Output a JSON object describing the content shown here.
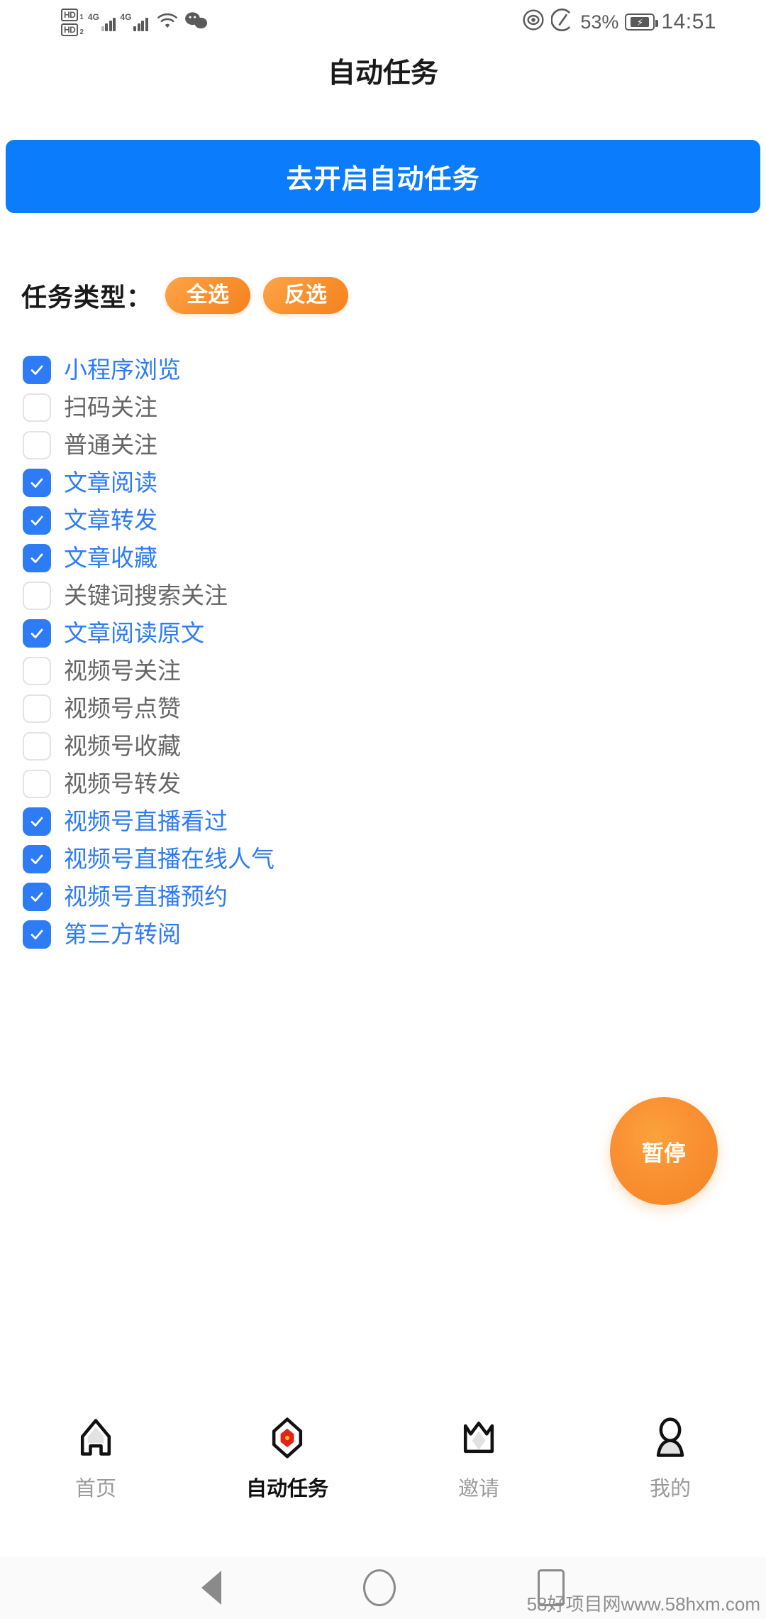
{
  "status_bar": {
    "hd1_label": "HD",
    "hd1_sim": "1",
    "hd2_label": "HD",
    "hd2_sim": "2",
    "net1": "4G",
    "net2": "4G",
    "battery_percent": "53%",
    "time": "14:51",
    "icons": [
      "hd-dual-sim-icon",
      "signal-4g-icon",
      "signal-4g-icon",
      "wifi-icon",
      "wechat-icon",
      "eye-icon",
      "speed-meter-icon",
      "battery-charging-icon"
    ]
  },
  "header": {
    "title": "自动任务"
  },
  "primary_button": {
    "label": "去开启自动任务",
    "color": "#0A7CFC"
  },
  "task_type": {
    "label": "任务类型：",
    "select_all": "全选",
    "invert": "反选",
    "pill_color": "#F58220"
  },
  "tasks": [
    {
      "label": "小程序浏览",
      "checked": true
    },
    {
      "label": "扫码关注",
      "checked": false
    },
    {
      "label": "普通关注",
      "checked": false
    },
    {
      "label": "文章阅读",
      "checked": true
    },
    {
      "label": "文章转发",
      "checked": true
    },
    {
      "label": "文章收藏",
      "checked": true
    },
    {
      "label": "关键词搜索关注",
      "checked": false
    },
    {
      "label": "文章阅读原文",
      "checked": true
    },
    {
      "label": "视频号关注",
      "checked": false
    },
    {
      "label": "视频号点赞",
      "checked": false
    },
    {
      "label": "视频号收藏",
      "checked": false
    },
    {
      "label": "视频号转发",
      "checked": false
    },
    {
      "label": "视频号直播看过",
      "checked": true
    },
    {
      "label": "视频号直播在线人气",
      "checked": true
    },
    {
      "label": "视频号直播预约",
      "checked": true
    },
    {
      "label": "第三方转阅",
      "checked": true
    }
  ],
  "checkbox_colors": {
    "checked": "#2E7BF6",
    "unchecked_border": "#E3E3E5"
  },
  "fab": {
    "label": "暂停",
    "color": "#F48422"
  },
  "tabbar": {
    "items": [
      {
        "label": "首页",
        "icon": "home-icon",
        "active": false
      },
      {
        "label": "自动任务",
        "icon": "hexagon-task-icon",
        "active": true
      },
      {
        "label": "邀请",
        "icon": "crown-gift-icon",
        "active": false
      },
      {
        "label": "我的",
        "icon": "person-icon",
        "active": false
      }
    ]
  },
  "android_nav": {
    "back": "back-triangle-icon",
    "home": "home-circle-icon",
    "recents": "recents-square-icon"
  },
  "watermark": {
    "text": "58好项目网www.58hxm.com"
  }
}
